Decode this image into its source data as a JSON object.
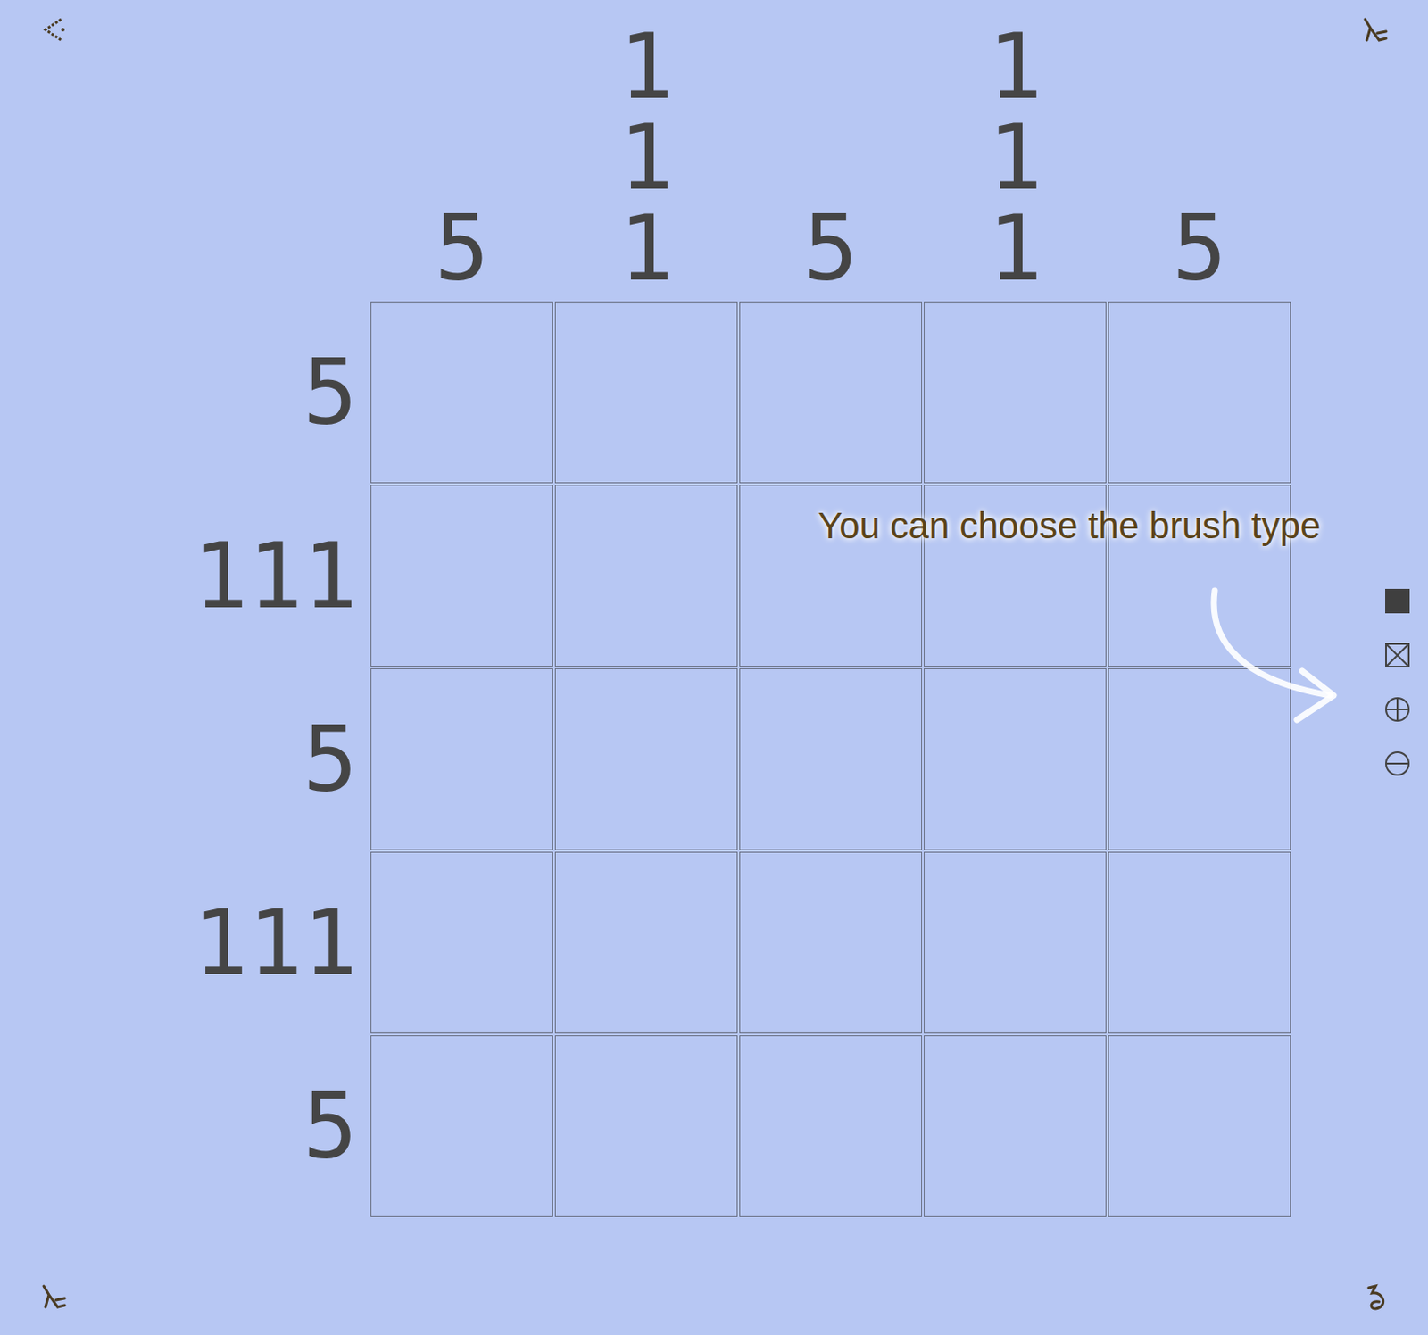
{
  "puzzle": {
    "columns": [
      {
        "clues": [
          "5"
        ]
      },
      {
        "clues": [
          "1",
          "1",
          "1"
        ]
      },
      {
        "clues": [
          "5"
        ]
      },
      {
        "clues": [
          "1",
          "1",
          "1"
        ]
      },
      {
        "clues": [
          "5"
        ]
      }
    ],
    "rows": [
      {
        "clues": [
          "5"
        ],
        "cells": [
          {
            "filled": false
          },
          {
            "filled": false
          },
          {
            "filled": false
          },
          {
            "filled": false
          },
          {
            "filled": false
          }
        ]
      },
      {
        "clues": [
          "1",
          "1",
          "1"
        ],
        "cells": [
          {
            "filled": false
          },
          {
            "filled": false
          },
          {
            "filled": false
          },
          {
            "filled": false
          },
          {
            "filled": false
          }
        ]
      },
      {
        "clues": [
          "5"
        ],
        "cells": [
          {
            "filled": false
          },
          {
            "filled": false
          },
          {
            "filled": false
          },
          {
            "filled": false
          },
          {
            "filled": false
          }
        ]
      },
      {
        "clues": [
          "1",
          "1",
          "1"
        ],
        "cells": [
          {
            "filled": false
          },
          {
            "filled": false
          },
          {
            "filled": false
          },
          {
            "filled": false
          },
          {
            "filled": false
          }
        ]
      },
      {
        "clues": [
          "5"
        ],
        "cells": [
          {
            "filled": false
          },
          {
            "filled": false
          },
          {
            "filled": false
          },
          {
            "filled": false
          },
          {
            "filled": false
          }
        ]
      }
    ]
  },
  "hint": {
    "text": "You can choose the brush type"
  },
  "tools": [
    {
      "kind": "fill"
    },
    {
      "kind": "cross"
    },
    {
      "kind": "zoom-in"
    },
    {
      "kind": "zoom-out"
    }
  ]
}
